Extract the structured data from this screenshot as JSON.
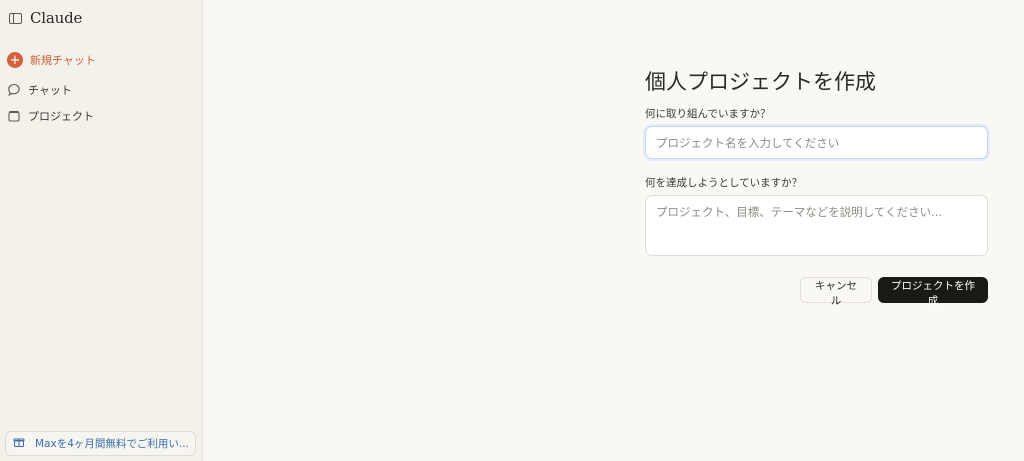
{
  "sidebar": {
    "logo": "Claude",
    "items": [
      {
        "label": "新規チャット"
      },
      {
        "label": "チャット"
      },
      {
        "label": "プロジェクト"
      }
    ],
    "promo": "Maxを4ヶ月間無料でご利用い..."
  },
  "form": {
    "title": "個人プロジェクトを作成",
    "name_label": "何に取り組んでいますか？",
    "name_placeholder": "プロジェクト名を入力してください",
    "name_value": "",
    "desc_label": "何を達成しようとしていますか？",
    "desc_placeholder": "プロジェクト、目標、テーマなどを説明してください...",
    "desc_value": "",
    "cancel_label": "キャンセル",
    "create_label": "プロジェクトを作成"
  },
  "colors": {
    "accent": "#d2613e",
    "promo_text": "#3a6fb0",
    "primary_button": "#1a1915"
  }
}
